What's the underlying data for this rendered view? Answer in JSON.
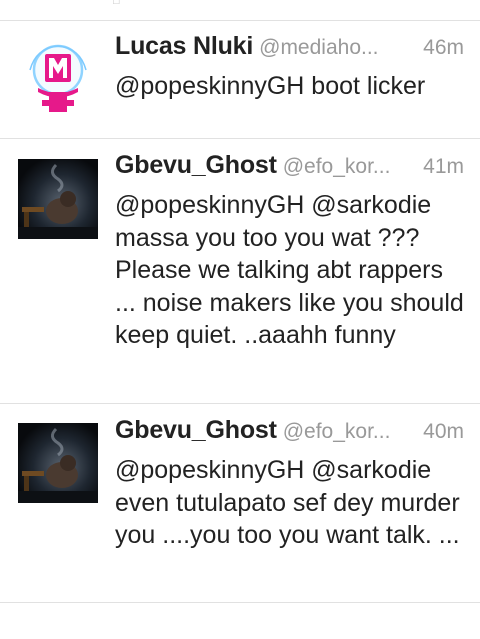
{
  "timeline": {
    "tweets": [
      {
        "name": "Lucas Nluki",
        "handle": "@mediaho...",
        "time": "46m",
        "text": "@popeskinnyGH boot licker",
        "avatar": "mediahousegh-logo-avatar"
      },
      {
        "name": "Gbevu_Ghost",
        "handle": "@efo_kor...",
        "time": "41m",
        "text": "@popeskinnyGH @sarkodie massa you too you wat ??? Please we talking abt rappers ... noise makers like you should keep quiet. ..aaahh funny",
        "avatar": "dark-smoky-photo-avatar"
      },
      {
        "name": "Gbevu_Ghost",
        "handle": "@efo_kor...",
        "time": "40m",
        "text": "@popeskinnyGH @sarkodie even tutulapato sef dey murder you ....you too you want talk. ...",
        "avatar": "dark-smoky-photo-avatar"
      }
    ]
  },
  "colors": {
    "name": "#222222",
    "meta": "#999999",
    "divider": "#e1e1e1",
    "logo_pink": "#e6198a"
  }
}
